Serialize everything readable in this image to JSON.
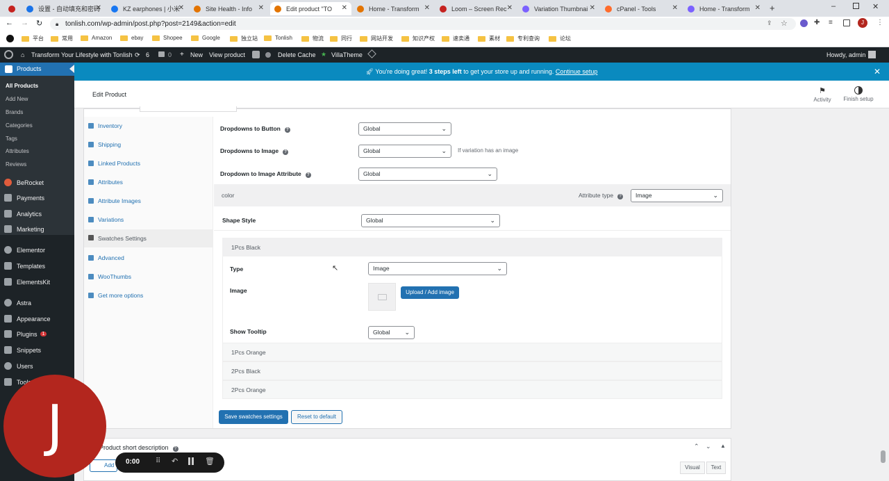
{
  "browser": {
    "tabs": [
      {
        "title": "",
        "active": false,
        "color": "#c5221f"
      },
      {
        "title": "设置 - 自动填充和密码",
        "active": false,
        "color": "#1a73e8"
      },
      {
        "title": "KZ earphones | 小米",
        "active": false,
        "color": "#1877f2"
      },
      {
        "title": "Site Health - Info",
        "active": false,
        "color": "#e37400"
      },
      {
        "title": "Edit product \"TO",
        "active": true,
        "color": "#e37400"
      },
      {
        "title": "Home - Transform",
        "active": false,
        "color": "#e37400"
      },
      {
        "title": "Loom – Screen Rec",
        "active": false,
        "color": "#c5221f"
      },
      {
        "title": "Variation Thumbnai",
        "active": false,
        "color": "#7b61ff"
      },
      {
        "title": "cPanel - Tools",
        "active": false,
        "color": "#ff6c2c"
      },
      {
        "title": "Home - Transform",
        "active": false,
        "color": "#7b61ff"
      }
    ],
    "url": "tonlish.com/wp-admin/post.php?post=2149&action=edit",
    "bookmarks": [
      "平台",
      "常用",
      "Amazon",
      "ebay",
      "Shopee",
      "Google",
      "独立站",
      "Tonlish",
      "物流",
      "同行",
      "网站开发",
      "知识产权",
      "速卖通",
      "素材",
      "专利查询",
      "论坛"
    ]
  },
  "adminbar": {
    "site_name": "Transform Your Lifestyle with Tonlish",
    "updates": "6",
    "comments": "0",
    "new_label": "New",
    "view_product": "View product",
    "delete_cache": "Delete Cache",
    "villa_theme": "VillaTheme",
    "howdy": "Howdy, admin"
  },
  "sidebar": {
    "current": "Products",
    "submenu": [
      "All Products",
      "Add New",
      "Brands",
      "Categories",
      "Tags",
      "Attributes",
      "Reviews"
    ],
    "menu": [
      "BeRocket",
      "Payments",
      "Analytics",
      "Marketing",
      "Elementor",
      "Templates",
      "ElementsKit",
      "Astra",
      "Appearance",
      "Plugins",
      "Snippets",
      "Users",
      "Tools"
    ],
    "plugins_badge": "1"
  },
  "banner": {
    "prefix": "You're doing great! ",
    "bold": "3 steps left",
    "middle": " to get your store up and running. ",
    "link": "Continue setup"
  },
  "header": {
    "title": "Edit Product",
    "activity": "Activity",
    "finish_setup": "Finish setup"
  },
  "product_tabs": [
    "Inventory",
    "Shipping",
    "Linked Products",
    "Attributes",
    "Attribute Images",
    "Variations",
    "Swatches Settings",
    "Advanced",
    "WooThumbs",
    "Get more options"
  ],
  "swatches": {
    "dropdowns_to_button": {
      "label": "Dropdowns to Button",
      "value": "Global"
    },
    "dropdowns_to_image": {
      "label": "Dropdowns to Image",
      "value": "Global",
      "note": "If variation has an image"
    },
    "dropdown_to_image_attribute": {
      "label": "Dropdown to Image Attribute",
      "value": "Global"
    },
    "attribute_name": "color",
    "attribute_type_label": "Attribute type",
    "attribute_type_value": "Image",
    "shape_style": {
      "label": "Shape Style",
      "value": "Global"
    },
    "terms": [
      "1Pcs Black",
      "1Pcs Orange",
      "2Pcs Black",
      "2Pcs Orange"
    ],
    "type": {
      "label": "Type",
      "value": "Image"
    },
    "image_label": "Image",
    "upload_button": "Upload / Add image",
    "tooltip": {
      "label": "Show Tooltip",
      "value": "Global"
    },
    "save_button": "Save swatches settings",
    "reset_button": "Reset to default"
  },
  "short_desc": {
    "title": "Product short description",
    "add_media": "Add",
    "visual": "Visual",
    "text": "Text"
  },
  "loom": {
    "avatar": "J",
    "timer": "0:00"
  }
}
